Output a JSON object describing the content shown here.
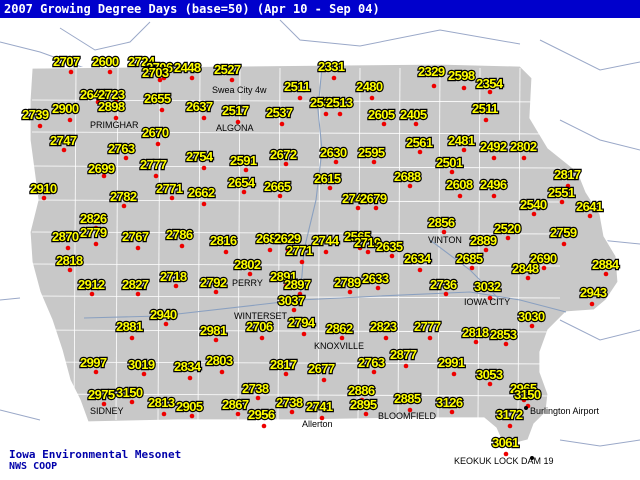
{
  "title": "2007 Growing Degree Days (base=50) (Apr 10 - Sep 04)",
  "credits": {
    "line1": "Iowa Environmental Mesonet",
    "line2": "NWS COOP"
  },
  "colors": {
    "title_bar": "#0000cc",
    "state_fill": "#c8c8c8",
    "county_lines": "#ffffff",
    "rivers": "#8aa0c0",
    "station_dot": "#ee0000",
    "value_text": "#ffff00",
    "value_outline": "#000000"
  },
  "cities": [
    "Swea City 4w",
    "PRIMGHAR",
    "ALGONA",
    "VINTON",
    "PERRY",
    "IOWA CITY",
    "WINTERSET",
    "KNOXVILLE",
    "SIDNEY",
    "Allerton",
    "BLOOMFIELD",
    "Burlington Airport",
    "KEOKUK LOCK DAM 19"
  ],
  "stations": [
    {
      "value": "2707"
    },
    {
      "value": "2600"
    },
    {
      "value": "2724"
    },
    {
      "value": "2706"
    },
    {
      "value": "2448"
    },
    {
      "value": "2527"
    },
    {
      "value": "2331"
    },
    {
      "value": "2329"
    },
    {
      "value": "2598"
    },
    {
      "value": "2354"
    },
    {
      "value": "2703"
    },
    {
      "value": "2649"
    },
    {
      "value": "2723"
    },
    {
      "value": "2898"
    },
    {
      "value": "2655"
    },
    {
      "value": "2511"
    },
    {
      "value": "2480"
    },
    {
      "value": "2739"
    },
    {
      "value": "2900"
    },
    {
      "value": "2637"
    },
    {
      "value": "2517"
    },
    {
      "value": "2537"
    },
    {
      "value": "2538"
    },
    {
      "value": "2513"
    },
    {
      "value": "2605"
    },
    {
      "value": "2405"
    },
    {
      "value": "2511"
    },
    {
      "value": "2747"
    },
    {
      "value": "2670"
    },
    {
      "value": "2763"
    },
    {
      "value": "2561"
    },
    {
      "value": "2481"
    },
    {
      "value": "2492"
    },
    {
      "value": "2802"
    },
    {
      "value": "2754"
    },
    {
      "value": "2591"
    },
    {
      "value": "2672"
    },
    {
      "value": "2630"
    },
    {
      "value": "2595"
    },
    {
      "value": "2699"
    },
    {
      "value": "2777"
    },
    {
      "value": "2501"
    },
    {
      "value": "2817"
    },
    {
      "value": "2688"
    },
    {
      "value": "2615"
    },
    {
      "value": "2654"
    },
    {
      "value": "2910"
    },
    {
      "value": "2771"
    },
    {
      "value": "2665"
    },
    {
      "value": "2608"
    },
    {
      "value": "2496"
    },
    {
      "value": "2551"
    },
    {
      "value": "2782"
    },
    {
      "value": "2662"
    },
    {
      "value": "2743"
    },
    {
      "value": "2679"
    },
    {
      "value": "2540"
    },
    {
      "value": "2641"
    },
    {
      "value": "2826"
    },
    {
      "value": "2856"
    },
    {
      "value": "2870"
    },
    {
      "value": "2779"
    },
    {
      "value": "2767"
    },
    {
      "value": "2786"
    },
    {
      "value": "2816"
    },
    {
      "value": "2682"
    },
    {
      "value": "2629"
    },
    {
      "value": "2771"
    },
    {
      "value": "2744"
    },
    {
      "value": "2565"
    },
    {
      "value": "2520"
    },
    {
      "value": "2759"
    },
    {
      "value": "2719"
    },
    {
      "value": "2635"
    },
    {
      "value": "2889"
    },
    {
      "value": "2818"
    },
    {
      "value": "2634"
    },
    {
      "value": "2685"
    },
    {
      "value": "2690"
    },
    {
      "value": "2802"
    },
    {
      "value": "2848"
    },
    {
      "value": "2884"
    },
    {
      "value": "2718"
    },
    {
      "value": "2891"
    },
    {
      "value": "2912"
    },
    {
      "value": "2827"
    },
    {
      "value": "2792"
    },
    {
      "value": "2897"
    },
    {
      "value": "2789"
    },
    {
      "value": "2633"
    },
    {
      "value": "2736"
    },
    {
      "value": "3032"
    },
    {
      "value": "2943"
    },
    {
      "value": "3037"
    },
    {
      "value": "2940"
    },
    {
      "value": "3030"
    },
    {
      "value": "2881"
    },
    {
      "value": "2981"
    },
    {
      "value": "2706"
    },
    {
      "value": "2794"
    },
    {
      "value": "2862"
    },
    {
      "value": "2823"
    },
    {
      "value": "2777"
    },
    {
      "value": "2818"
    },
    {
      "value": "2853"
    },
    {
      "value": "2997"
    },
    {
      "value": "3019"
    },
    {
      "value": "2834"
    },
    {
      "value": "2803"
    },
    {
      "value": "2817"
    },
    {
      "value": "2677"
    },
    {
      "value": "2763"
    },
    {
      "value": "2877"
    },
    {
      "value": "2991"
    },
    {
      "value": "3053"
    },
    {
      "value": "2975"
    },
    {
      "value": "3150"
    },
    {
      "value": "2738"
    },
    {
      "value": "2886"
    },
    {
      "value": "2813"
    },
    {
      "value": "2905"
    },
    {
      "value": "2867"
    },
    {
      "value": "2738"
    },
    {
      "value": "2741"
    },
    {
      "value": "2895"
    },
    {
      "value": "2885"
    },
    {
      "value": "3126"
    },
    {
      "value": "2965"
    },
    {
      "value": "3150"
    },
    {
      "value": "2956"
    },
    {
      "value": "3172"
    },
    {
      "value": "3061"
    }
  ]
}
